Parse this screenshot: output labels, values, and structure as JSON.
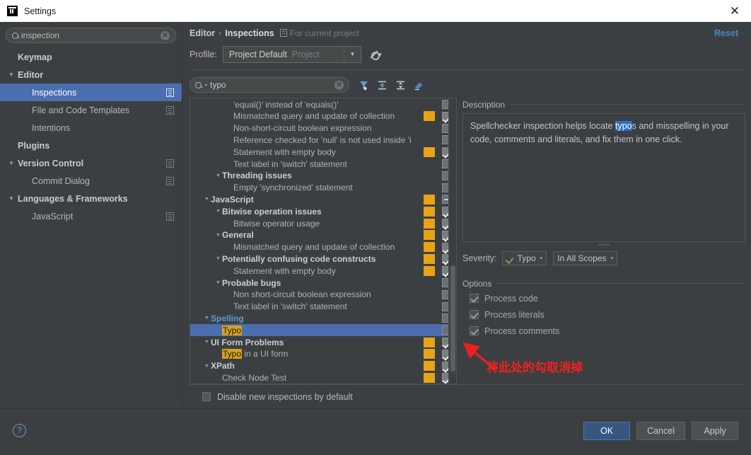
{
  "window": {
    "title": "Settings",
    "close_label": "✕",
    "logo": "intellij-logo"
  },
  "sidebar": {
    "search": {
      "value": "inspection",
      "clear": "✕"
    },
    "items": [
      {
        "label": "Keymap",
        "level": 1,
        "bold": true,
        "arrow": "",
        "selected": false,
        "icon": false
      },
      {
        "label": "Editor",
        "level": 0,
        "bold": true,
        "arrow": "▼",
        "selected": false,
        "icon": false
      },
      {
        "label": "Inspections",
        "level": 2,
        "bold": false,
        "arrow": "",
        "selected": true,
        "icon": true
      },
      {
        "label": "File and Code Templates",
        "level": 2,
        "bold": false,
        "arrow": "",
        "selected": false,
        "icon": true
      },
      {
        "label": "Intentions",
        "level": 2,
        "bold": false,
        "arrow": "",
        "selected": false,
        "icon": false
      },
      {
        "label": "Plugins",
        "level": 1,
        "bold": true,
        "arrow": "",
        "selected": false,
        "icon": false
      },
      {
        "label": "Version Control",
        "level": 0,
        "bold": true,
        "arrow": "▼",
        "selected": false,
        "icon": true
      },
      {
        "label": "Commit Dialog",
        "level": 2,
        "bold": false,
        "arrow": "",
        "selected": false,
        "icon": true
      },
      {
        "label": "Languages & Frameworks",
        "level": 0,
        "bold": true,
        "arrow": "▼",
        "selected": false,
        "icon": false
      },
      {
        "label": "JavaScript",
        "level": 2,
        "bold": false,
        "arrow": "",
        "selected": false,
        "icon": true
      }
    ]
  },
  "breadcrumb": {
    "root": "Editor",
    "separator": "›",
    "current": "Inspections",
    "scope_text": "For current project",
    "reset_label": "Reset"
  },
  "profile": {
    "label": "Profile:",
    "value": "Project Default",
    "suffix": "Project",
    "dropdown_arrow": "▼",
    "gear_dot": "▾"
  },
  "filter": {
    "search_value": "typo",
    "search_arrow": "▾",
    "clear": "✕",
    "icons": [
      "filter-icon",
      "expand-all-icon",
      "collapse-all-icon",
      "reset-filter-icon"
    ]
  },
  "inspection_tree": [
    {
      "label": "'equal()' instead of 'equals()'",
      "level": 3,
      "group": false,
      "arrow": "",
      "swatch": false,
      "check": "off"
    },
    {
      "label": "Mismatched query and update of collection",
      "level": 3,
      "group": false,
      "arrow": "",
      "swatch": true,
      "check": "on"
    },
    {
      "label": "Non-short-circuit boolean expression",
      "level": 3,
      "group": false,
      "arrow": "",
      "swatch": false,
      "check": "off"
    },
    {
      "label": "Reference checked for 'null' is not used inside 'i",
      "level": 3,
      "group": false,
      "arrow": "",
      "swatch": false,
      "check": "off"
    },
    {
      "label": "Statement with empty body",
      "level": 3,
      "group": false,
      "arrow": "",
      "swatch": true,
      "check": "on"
    },
    {
      "label": "Text label in 'switch' statement",
      "level": 3,
      "group": false,
      "arrow": "",
      "swatch": false,
      "check": "off"
    },
    {
      "label": "Threading issues",
      "level": 2,
      "group": true,
      "arrow": "▼",
      "swatch": false,
      "check": "off"
    },
    {
      "label": "Empty 'synchronized' statement",
      "level": 3,
      "group": false,
      "arrow": "",
      "swatch": false,
      "check": "off"
    },
    {
      "label": "JavaScript",
      "level": 1,
      "group": true,
      "arrow": "▼",
      "swatch": true,
      "check": "part"
    },
    {
      "label": "Bitwise operation issues",
      "level": 2,
      "group": true,
      "arrow": "▼",
      "swatch": true,
      "check": "on"
    },
    {
      "label": "Bitwise operator usage",
      "level": 3,
      "group": false,
      "arrow": "",
      "swatch": true,
      "check": "on"
    },
    {
      "label": "General",
      "level": 2,
      "group": true,
      "arrow": "▼",
      "swatch": true,
      "check": "on"
    },
    {
      "label": "Mismatched query and update of collection",
      "level": 3,
      "group": false,
      "arrow": "",
      "swatch": true,
      "check": "on"
    },
    {
      "label": "Potentially confusing code constructs",
      "level": 2,
      "group": true,
      "arrow": "▼",
      "swatch": true,
      "check": "on"
    },
    {
      "label": "Statement with empty body",
      "level": 3,
      "group": false,
      "arrow": "",
      "swatch": true,
      "check": "on"
    },
    {
      "label": "Probable bugs",
      "level": 2,
      "group": true,
      "arrow": "▼",
      "swatch": false,
      "check": "off"
    },
    {
      "label": "Non short-circuit boolean expression",
      "level": 3,
      "group": false,
      "arrow": "",
      "swatch": false,
      "check": "off"
    },
    {
      "label": "Text label in 'switch' statement",
      "level": 3,
      "group": false,
      "arrow": "",
      "swatch": false,
      "check": "off"
    },
    {
      "label": "Spelling",
      "level": 1,
      "group": true,
      "arrow": "▼",
      "swatch": false,
      "check": "off",
      "match": true
    },
    {
      "label": "Typo",
      "level": 2,
      "group": false,
      "arrow": "",
      "swatch": false,
      "check": "off",
      "selected": true,
      "highlight": "Typo"
    },
    {
      "label": "UI Form Problems",
      "level": 1,
      "group": true,
      "arrow": "▼",
      "swatch": true,
      "check": "on"
    },
    {
      "label": "Typo in a UI form",
      "level": 2,
      "group": false,
      "arrow": "",
      "swatch": true,
      "check": "on",
      "highlight": "Typo"
    },
    {
      "label": "XPath",
      "level": 1,
      "group": true,
      "arrow": "▼",
      "swatch": true,
      "check": "on"
    },
    {
      "label": "Check Node Test",
      "level": 2,
      "group": false,
      "arrow": "",
      "swatch": true,
      "check": "on"
    }
  ],
  "description": {
    "header": "Description",
    "text_before": "Spellchecker inspection helps locate ",
    "highlighted": "typo",
    "text_after": "s and misspelling in your code, comments and literals, and fix them in one click."
  },
  "severity": {
    "label": "Severity:",
    "value": "Typo",
    "arrow": "▾",
    "scope": "In All Scopes",
    "scope_arrow": "▾"
  },
  "options": {
    "header": "Options",
    "items": [
      {
        "label": "Process code",
        "checked": true
      },
      {
        "label": "Process literals",
        "checked": true
      },
      {
        "label": "Process comments",
        "checked": true
      }
    ]
  },
  "annotation": {
    "text": "将此处的勾取消掉",
    "color": "#f02020"
  },
  "bottom": {
    "disable_new_label": "Disable new inspections by default",
    "help": "?",
    "ok": "OK",
    "cancel": "Cancel",
    "apply": "Apply"
  },
  "colors": {
    "selection": "#4b6eaf",
    "accent_link": "#4a88c7",
    "severity_swatch": "#e8a317",
    "highlight_yellow": "#d8a21a",
    "annotation_red": "#f02020"
  }
}
